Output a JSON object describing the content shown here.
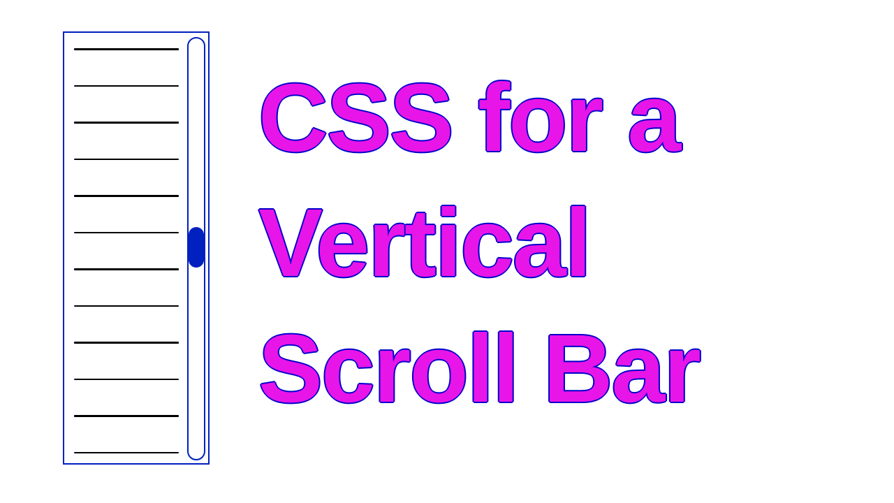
{
  "title": {
    "line1": "CSS for a",
    "line2": "Vertical",
    "line3": "Scroll Bar"
  },
  "colors": {
    "accent_blue": "#0020c0",
    "title_magenta": "#e815e8",
    "title_outline": "#0000cc"
  },
  "diagram": {
    "line_count": 12,
    "thumb_position_pct": 45
  }
}
